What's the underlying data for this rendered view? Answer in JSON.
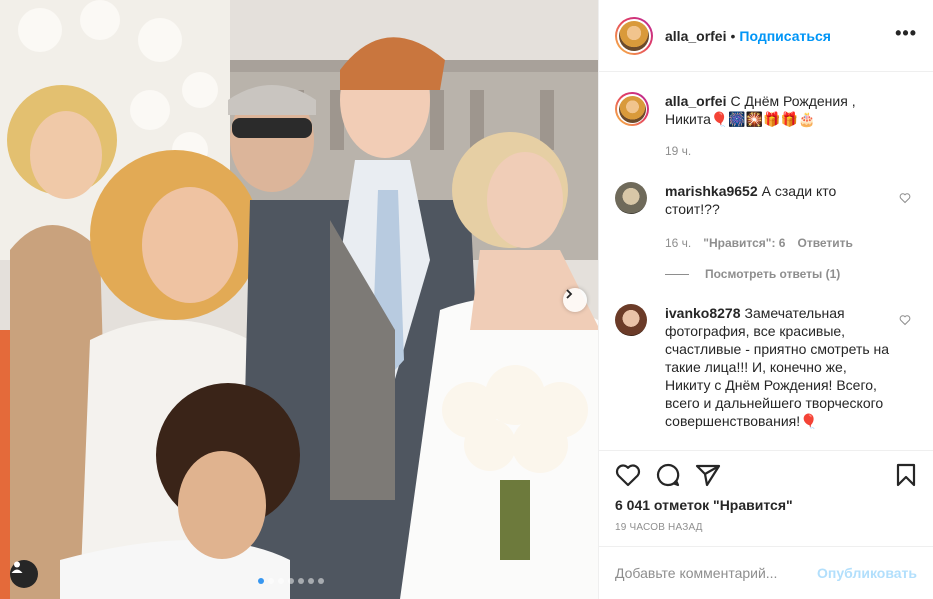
{
  "post": {
    "username": "alla_orfei",
    "separator": "•",
    "follow_label": "Подписаться",
    "more_label": "•••",
    "caption_user": "alla_orfei",
    "caption_text": "С Днём Рождения , Никита🎈🎆🎇🎁🎁🎂",
    "caption_time": "19 ч.",
    "likes_text": "6 041 отметок \"Нравится\"",
    "posted_time": "19 ЧАСОВ НАЗАД",
    "carousel_slides": 7,
    "active_slide": 1
  },
  "comments": [
    {
      "username": "marishka9652",
      "text": "А сзади кто стоит!??",
      "time": "16 ч.",
      "likes": "\"Нравится\": 6",
      "reply_label": "Ответить",
      "view_replies": "Посмотреть ответы (1)"
    },
    {
      "username": "ivanko8278",
      "text": "Замечательная фотография, все красивые, счастливые - приятно смотреть на такие лица!!! И, конечно же, Никиту с Днём Рождения! Всего, всего и дальнейшего творческого совершенствования!🎈"
    }
  ],
  "add_comment": {
    "placeholder": "Добавьте комментарий...",
    "publish_label": "Опубликовать"
  },
  "colors": {
    "link_blue": "#0095f6",
    "publish_disabled": "#b2dffc",
    "muted": "#8e8e8e",
    "text": "#262626"
  },
  "icons": [
    "heart-icon",
    "comment-icon",
    "share-icon",
    "bookmark-icon",
    "more-icon",
    "chevron-right-icon",
    "user-tag-icon"
  ]
}
